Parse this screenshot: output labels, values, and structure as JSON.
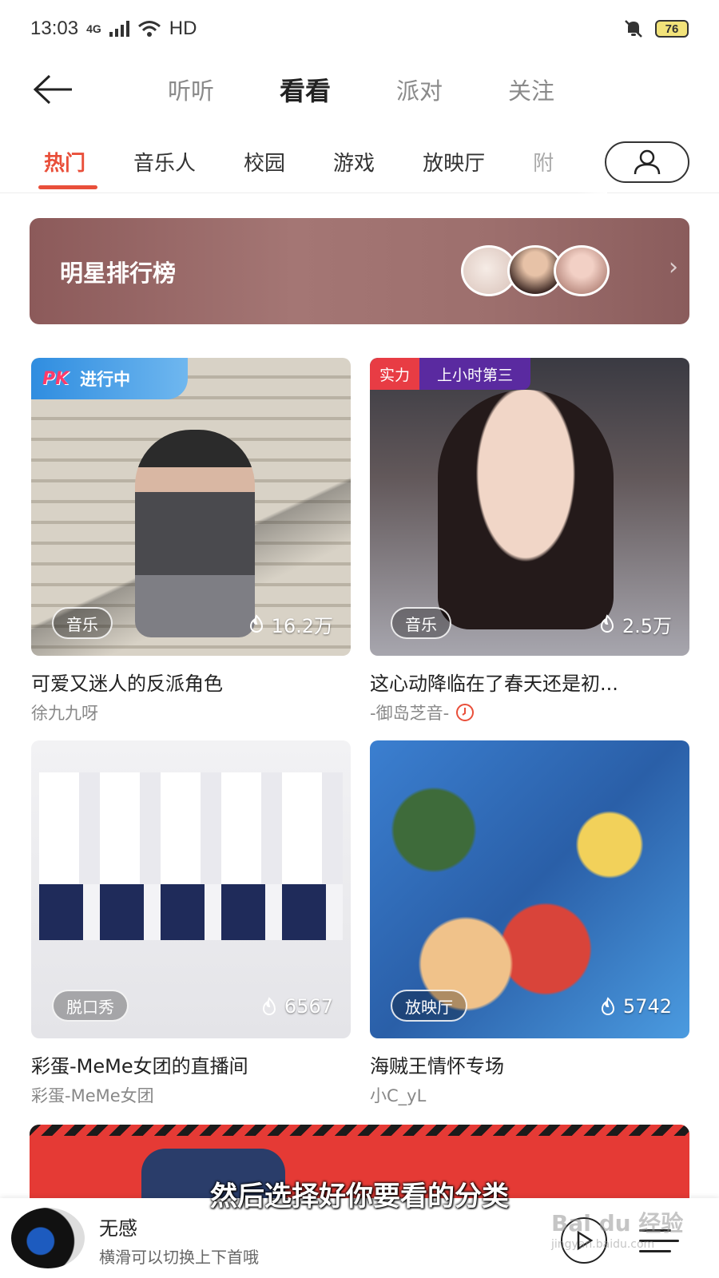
{
  "status_bar": {
    "time": "13:03",
    "network": "4G",
    "hd": "HD",
    "battery": "76"
  },
  "header": {
    "tabs": [
      "听听",
      "看看",
      "派对",
      "关注"
    ],
    "active_tab": "看看"
  },
  "categories": {
    "items": [
      "热门",
      "音乐人",
      "校园",
      "游戏",
      "放映厅",
      "附"
    ],
    "active": "热门"
  },
  "banner": {
    "title": "明星排行榜"
  },
  "cards": [
    {
      "title": "可爱又迷人的反派角色",
      "author": "徐九九呀",
      "tag": "音乐",
      "heat": "16.2万",
      "badge_logo": "PK",
      "badge_text": "进行中"
    },
    {
      "title": "这心动降临在了春天还是初...",
      "author": "-御岛芝音-",
      "tag": "音乐",
      "heat": "2.5万",
      "rank_a": "实力",
      "rank_b": "上小时第三"
    },
    {
      "title": "彩蛋-MeMe女团的直播间",
      "author": "彩蛋-MeMe女团",
      "tag": "脱口秀",
      "heat": "6567"
    },
    {
      "title": "海贼王情怀专场",
      "author": "小C_yL",
      "tag": "放映厅",
      "heat": "5742"
    }
  ],
  "subtitle": "然后选择好你要看的分类",
  "player": {
    "title": "无感",
    "subtitle": "横滑可以切换上下首哦"
  },
  "watermark": {
    "brand": "Bai du 经验",
    "url": "jingyan.baidu.com"
  },
  "colors": {
    "accent": "#e94f3a",
    "banner": "#9d6f6d",
    "rank_a": "#e83c44",
    "rank_b": "#5a2aa0"
  }
}
